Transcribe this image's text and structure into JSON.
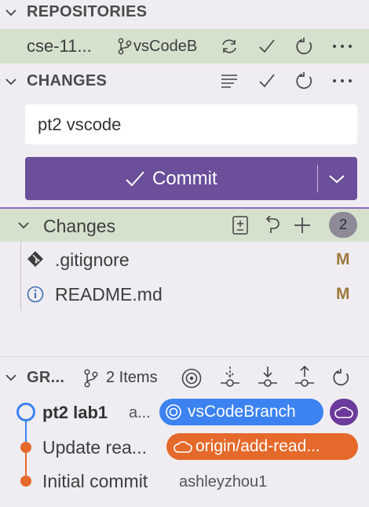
{
  "repositories": {
    "header": "REPOSITORIES",
    "repo_name": "cse-11...",
    "branch": "vsCodeB",
    "sync_icon": "sync-icon",
    "check_icon": "check-icon",
    "refresh_icon": "refresh-icon",
    "more_icon": "more-icon"
  },
  "changes_section": {
    "header": "CHANGES",
    "message_value": "pt2 vscode",
    "commit_label": "Commit",
    "group": {
      "label": "Changes",
      "count": "2"
    },
    "files": [
      {
        "name": ".gitignore",
        "status": "M",
        "icon": "git-file-icon"
      },
      {
        "name": "README.md",
        "status": "M",
        "icon": "info-file-icon"
      }
    ]
  },
  "graph": {
    "header": "GR...",
    "items_label": "2 Items",
    "commits": [
      {
        "message": "pt2 lab1",
        "author": "a...",
        "ref": "vsCodeBranch",
        "ref_color": "#3c82f0"
      },
      {
        "message": "Update rea...",
        "ref": "origin/add-read...",
        "ref_color": "#e5692a"
      },
      {
        "message": "Initial commit",
        "author": "ashleyzhou1"
      }
    ]
  },
  "colors": {
    "accent_purple": "#6b4f9a",
    "row_highlight": "#d5e1cd",
    "branch_blue": "#3c82f0",
    "origin_orange": "#e5692a",
    "status_modified": "#9b7a3c"
  }
}
